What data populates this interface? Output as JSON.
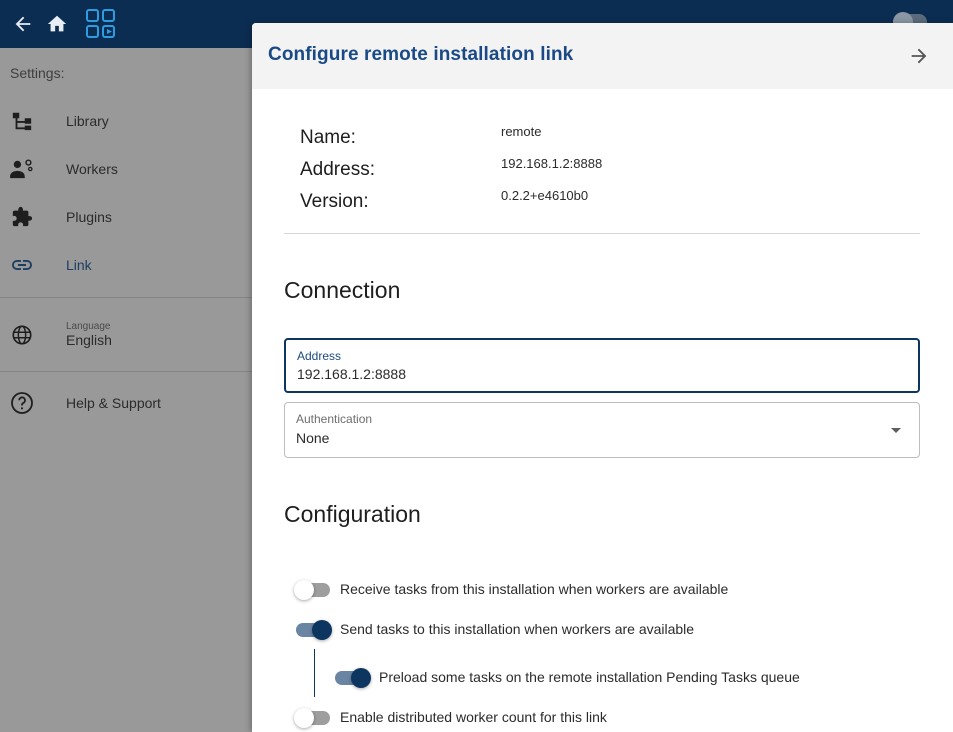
{
  "topbar": {
    "back_icon": "arrow-left-icon",
    "home_icon": "home-icon",
    "logo_icon": "app-logo-icon",
    "theme_toggle_icon": "dark-mode-toggle-icon"
  },
  "drawer": {
    "header": "Settings:",
    "items": [
      {
        "label": "Library",
        "icon": "library-tree-icon"
      },
      {
        "label": "Workers",
        "icon": "workers-icon"
      },
      {
        "label": "Plugins",
        "icon": "puzzle-icon"
      },
      {
        "label": "Link",
        "icon": "link-icon"
      }
    ],
    "language": {
      "caption": "Language",
      "value": "English",
      "icon": "globe-icon"
    },
    "help": {
      "label": "Help & Support",
      "icon": "help-circle-icon"
    }
  },
  "panel": {
    "title": "Configure remote installation link",
    "close_icon": "arrow-right-icon",
    "info": {
      "name_label": "Name:",
      "name_value": "remote",
      "address_label": "Address:",
      "address_value": "192.168.1.2:8888",
      "version_label": "Version:",
      "version_value": "0.2.2+e4610b0"
    },
    "connection": {
      "title": "Connection",
      "address_field": {
        "caption": "Address",
        "value": "192.168.1.2:8888"
      },
      "auth_field": {
        "caption": "Authentication",
        "value": "None"
      }
    },
    "configuration": {
      "title": "Configuration",
      "toggles": [
        {
          "label": "Receive tasks from this installation when workers are available",
          "on": false
        },
        {
          "label": "Send tasks to this installation when workers are available",
          "on": true
        },
        {
          "label": "Preload some tasks on the remote installation Pending Tasks queue",
          "on": true
        },
        {
          "label": "Enable distributed worker count for this link",
          "on": false
        }
      ]
    }
  },
  "colors": {
    "topbar": "#0c2d52",
    "accent": "#1a4a85",
    "toggle_on": "#0c3560"
  }
}
